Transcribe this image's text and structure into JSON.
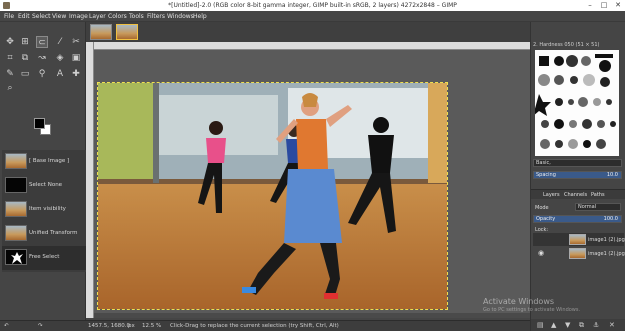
{
  "window": {
    "title": "*[Untitled]-2.0 (RGB color 8-bit gamma integer, GIMP built-in sRGB, 2 layers) 4272x2848 – GIMP",
    "controls": [
      "–",
      "□",
      "✕"
    ]
  },
  "menu": [
    "File",
    "Edit",
    "Select",
    "View",
    "Image",
    "Layer",
    "Colors",
    "Tools",
    "Filters",
    "Windows",
    "Help"
  ],
  "undo_history": [
    {
      "label": "[ Base Image ]",
      "thumb": "photo"
    },
    {
      "label": "Select None",
      "thumb": "black"
    },
    {
      "label": "Item visibility",
      "thumb": "photo"
    },
    {
      "label": "Unified Transform",
      "thumb": "photo"
    },
    {
      "label": "Free Select",
      "thumb": "dancer"
    }
  ],
  "brushes": {
    "header": "2. Hardness 050 (51 × 51)",
    "filter": "Basic,",
    "spacing_label": "Spacing",
    "spacing_value": "10.0"
  },
  "layers": {
    "tabs": [
      "Layers",
      "Channels",
      "Paths"
    ],
    "mode_label": "Mode",
    "mode_value": "Normal",
    "opacity_label": "Opacity",
    "opacity_value": "100.0",
    "lock_label": "Lock:",
    "items": [
      {
        "name": "image1 (2).jpg"
      },
      {
        "name": "image1 (2).jpg"
      }
    ]
  },
  "status": {
    "coords": "1457.5, 1680.0",
    "unit": "px",
    "zoom": "12.5 %",
    "message": "Click-Drag to replace the current selection (try Shift, Ctrl, Alt)"
  },
  "watermark": {
    "title": "Activate Windows",
    "subtitle": "Go to PC settings to activate Windows."
  },
  "colors": {
    "foreground": "#000000",
    "background": "#ffffff",
    "selection": "#f0e050"
  }
}
